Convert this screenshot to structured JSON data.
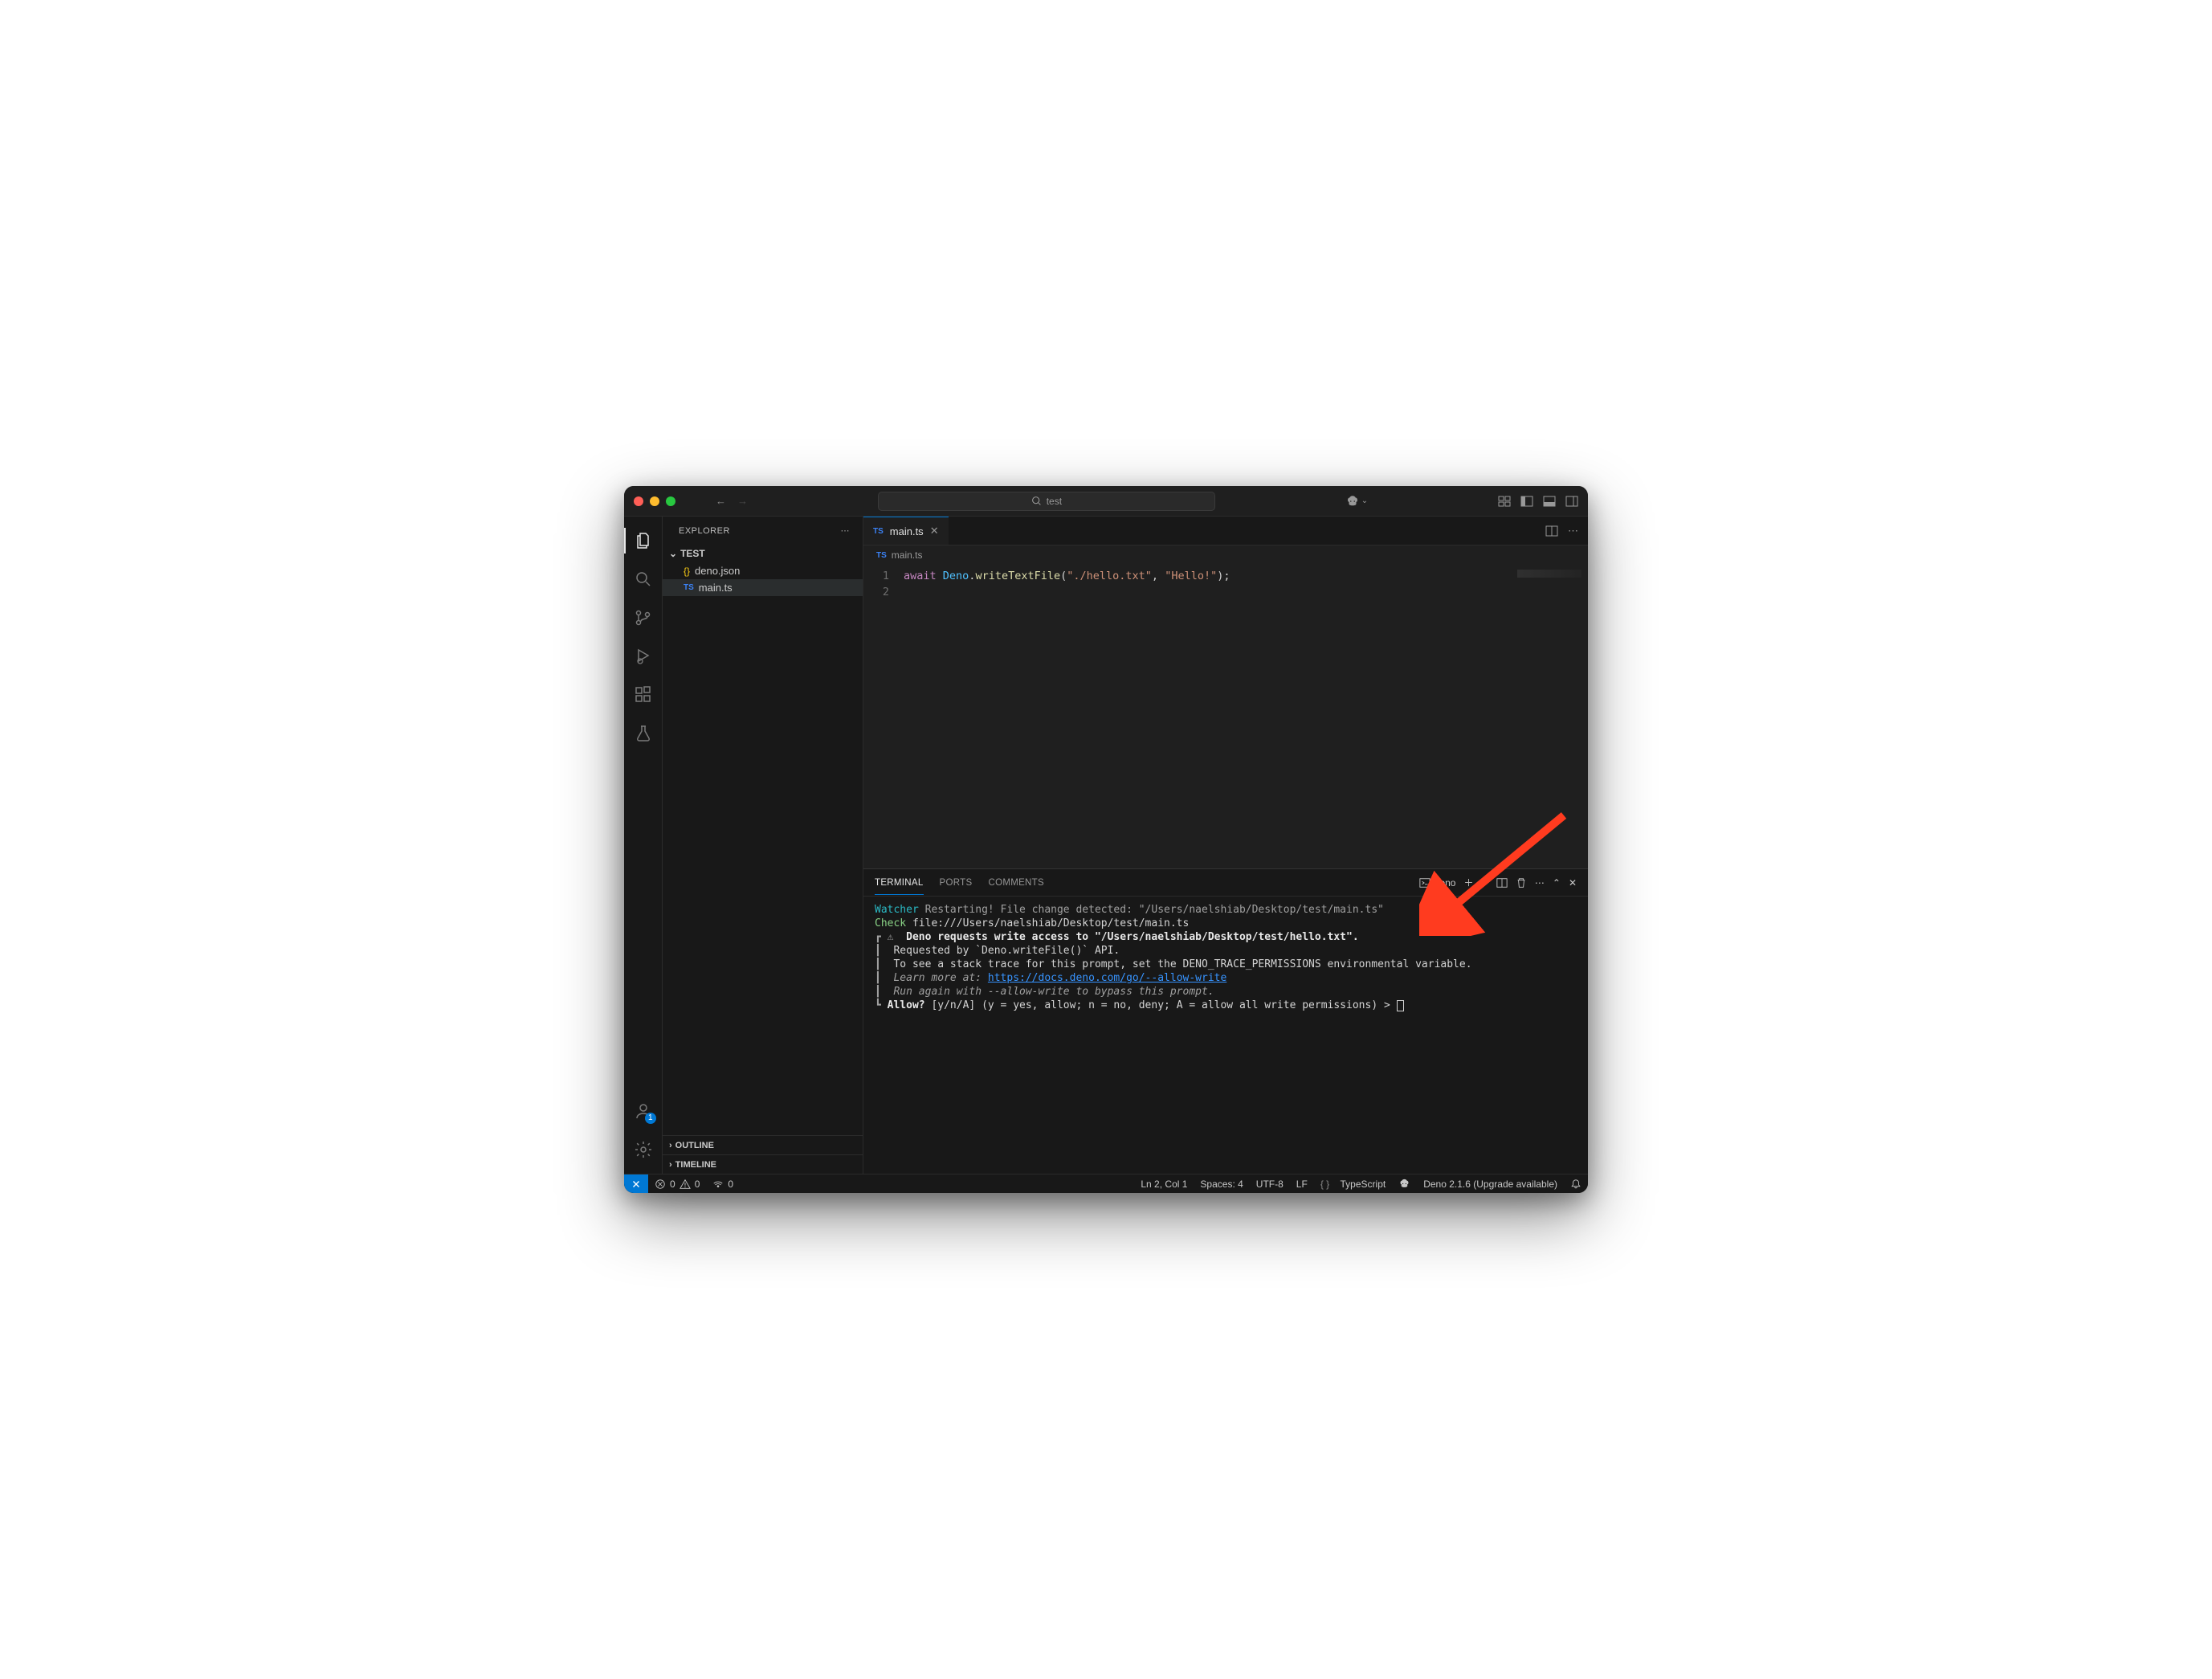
{
  "titlebar": {
    "search_placeholder": "test"
  },
  "sidebar": {
    "title": "EXPLORER",
    "root": "TEST",
    "files": [
      {
        "icon": "{}",
        "name": "deno.json"
      },
      {
        "icon": "TS",
        "name": "main.ts"
      }
    ],
    "sections": [
      "OUTLINE",
      "TIMELINE"
    ]
  },
  "tab": {
    "icon": "TS",
    "name": "main.ts"
  },
  "breadcrumb": {
    "icon": "TS",
    "name": "main.ts"
  },
  "editor": {
    "lines": [
      "1",
      "2"
    ],
    "code": {
      "kw": "await",
      "obj": "Deno",
      "dot": ".",
      "fn": "writeTextFile",
      "open": "(",
      "arg1": "\"./hello.txt\"",
      "comma": ", ",
      "arg2": "\"Hello!\"",
      "close": ");"
    }
  },
  "panel": {
    "tabs": [
      "TERMINAL",
      "PORTS",
      "COMMENTS"
    ],
    "shell": "deno",
    "output": {
      "watcher_label": "Watcher",
      "watcher_msg": " Restarting! File change detected: \"/Users/naelshiab/Desktop/test/main.ts\"",
      "check_label": "Check",
      "check_msg": " file:///Users/naelshiab/Desktop/test/main.ts",
      "box_top": "┏ ⚠  ",
      "req_bold": "Deno requests write access to \"/Users/naelshiab/Desktop/test/hello.txt\".",
      "side": "┃  ",
      "requested": "Requested by `Deno.writeFile()` API.",
      "trace": "To see a stack trace for this prompt, set the DENO_TRACE_PERMISSIONS environmental variable.",
      "learn_prefix": "Learn more at: ",
      "learn_link": "https://docs.deno.com/go/--allow-write",
      "runagain": "Run again with --allow-write to bypass this prompt.",
      "box_bottom": "┗ ",
      "allow_label": "Allow?",
      "allow_rest": " [y/n/A] (y = yes, allow; n = no, deny; A = allow all write permissions) > "
    }
  },
  "statusbar": {
    "errors": "0",
    "warnings": "0",
    "ports": "0",
    "lncol": "Ln 2, Col 1",
    "spaces": "Spaces: 4",
    "encoding": "UTF-8",
    "eol": "LF",
    "lang": "TypeScript",
    "deno": "Deno 2.1.6 (Upgrade available)"
  },
  "accounts_badge": "1"
}
